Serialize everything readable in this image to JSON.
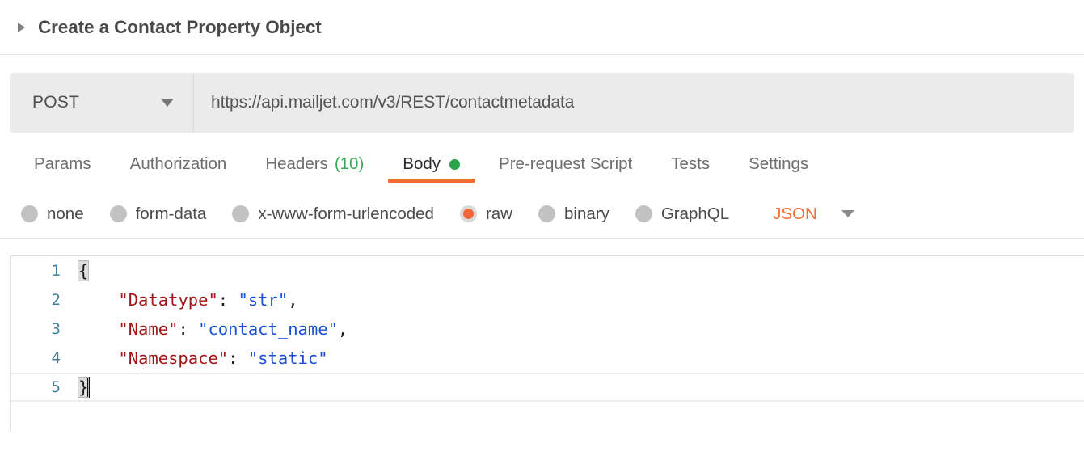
{
  "request": {
    "title": "Create a Contact Property Object",
    "collapsed_icon": "triangle-right-icon",
    "method": "POST",
    "method_caret_icon": "chevron-down-icon",
    "url": "https://api.mailjet.com/v3/REST/contactmetadata",
    "url_placeholder": "Enter request URL"
  },
  "tabs": [
    {
      "label": "Params",
      "active": false,
      "count": null,
      "dot": false
    },
    {
      "label": "Authorization",
      "active": false,
      "count": null,
      "dot": false
    },
    {
      "label": "Headers",
      "active": false,
      "count": "(10)",
      "dot": false
    },
    {
      "label": "Body",
      "active": true,
      "count": null,
      "dot": true
    },
    {
      "label": "Pre-request Script",
      "active": false,
      "count": null,
      "dot": false
    },
    {
      "label": "Tests",
      "active": false,
      "count": null,
      "dot": false
    },
    {
      "label": "Settings",
      "active": false,
      "count": null,
      "dot": false
    }
  ],
  "body_types": [
    {
      "label": "none",
      "selected": false
    },
    {
      "label": "form-data",
      "selected": false
    },
    {
      "label": "x-www-form-urlencoded",
      "selected": false
    },
    {
      "label": "raw",
      "selected": true
    },
    {
      "label": "binary",
      "selected": false
    },
    {
      "label": "GraphQL",
      "selected": false
    }
  ],
  "format_select": {
    "value": "JSON",
    "caret_icon": "chevron-down-icon"
  },
  "editor": {
    "lines": [
      {
        "number": "1",
        "segments": [
          {
            "text": "{",
            "type": "punct",
            "brace_match": true
          }
        ],
        "active": false,
        "caret": false
      },
      {
        "number": "2",
        "segments": [
          {
            "text": "    ",
            "type": "punct"
          },
          {
            "text": "\"Datatype\"",
            "type": "key"
          },
          {
            "text": ": ",
            "type": "punct"
          },
          {
            "text": "\"str\"",
            "type": "str"
          },
          {
            "text": ",",
            "type": "punct"
          }
        ],
        "active": false,
        "caret": false
      },
      {
        "number": "3",
        "segments": [
          {
            "text": "    ",
            "type": "punct"
          },
          {
            "text": "\"Name\"",
            "type": "key"
          },
          {
            "text": ": ",
            "type": "punct"
          },
          {
            "text": "\"contact_name\"",
            "type": "str"
          },
          {
            "text": ",",
            "type": "punct"
          }
        ],
        "active": false,
        "caret": false
      },
      {
        "number": "4",
        "segments": [
          {
            "text": "    ",
            "type": "punct"
          },
          {
            "text": "\"Namespace\"",
            "type": "key"
          },
          {
            "text": ": ",
            "type": "punct"
          },
          {
            "text": "\"static\"",
            "type": "str"
          }
        ],
        "active": false,
        "caret": false
      },
      {
        "number": "5",
        "segments": [
          {
            "text": "}",
            "type": "punct",
            "brace_match": true
          }
        ],
        "active": true,
        "caret": true
      }
    ]
  },
  "colors": {
    "accent_orange": "#ef6c33",
    "format_orange": "#f06e34",
    "status_green": "#2aa44a",
    "count_green": "#3aab55",
    "json_key": "#a31515",
    "json_string": "#1a4fd6",
    "gutter_blue": "#3f7f9f",
    "urlbar_bg": "#ebebeb"
  }
}
